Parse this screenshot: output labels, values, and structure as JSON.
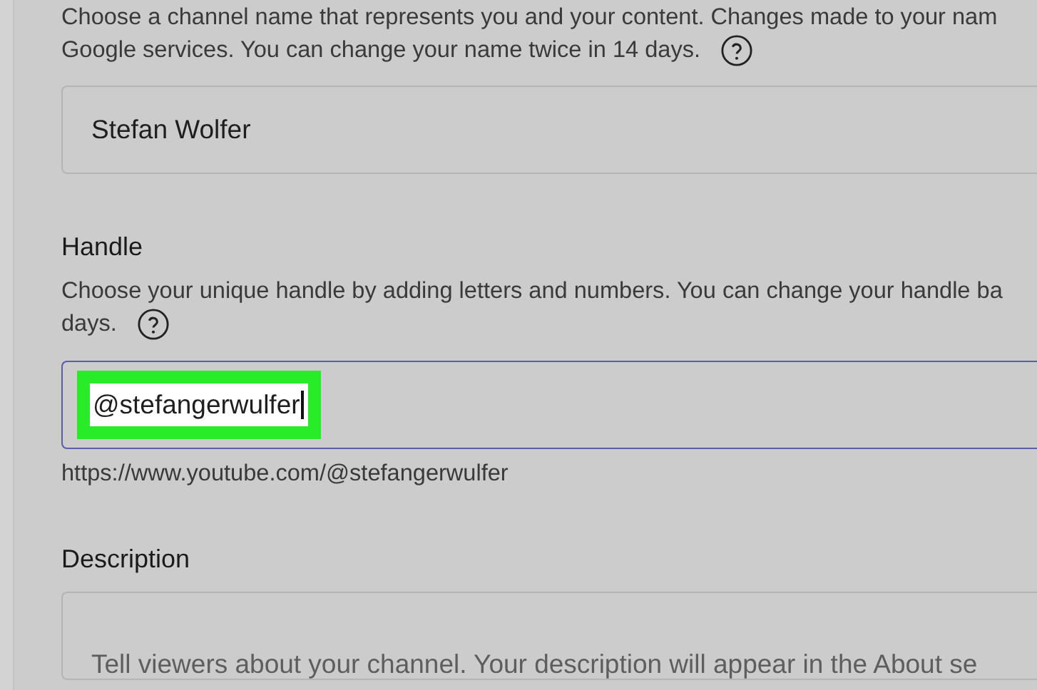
{
  "name_section": {
    "description": [
      "Choose a channel name that represents you and your content. Changes made to your nam",
      "Google services. You can change your name twice in 14 days."
    ],
    "help_icon": true,
    "field": {
      "value": "Stefan Wolfer",
      "focused": false
    }
  },
  "handle_section": {
    "title": "Handle",
    "description": [
      "Choose your unique handle by adding letters and numbers. You can change your handle ba",
      "days."
    ],
    "help_icon": true,
    "field": {
      "value": "@stefangerwulfer",
      "focused": true,
      "highlighted": true
    },
    "url": "https://www.youtube.com/@stefangerwulfer"
  },
  "description_section": {
    "title": "Description",
    "field": {
      "placeholder": "Tell viewers about your channel. Your description will appear in the About se",
      "focused": false
    }
  }
}
